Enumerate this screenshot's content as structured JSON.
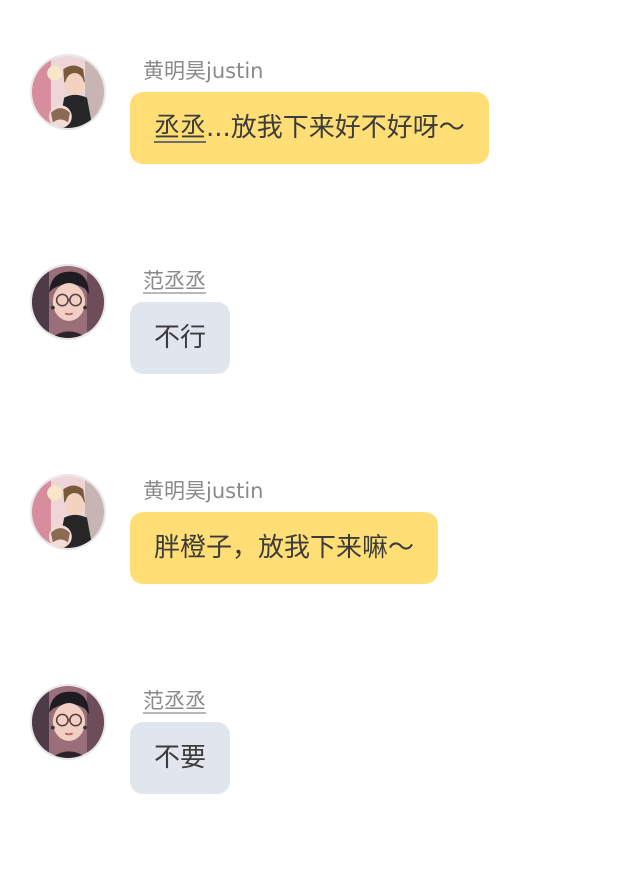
{
  "messages": [
    {
      "sender": "黄明昊justin",
      "avatar_icon": "avatar-huang-minghao-icon",
      "text_underlined": "丞丞",
      "text_rest": "...放我下来好不好呀～",
      "bubble_color": "#ffdf75"
    },
    {
      "sender": "范丞丞",
      "avatar_icon": "avatar-fan-chengcheng-icon",
      "text_underlined": "",
      "text_rest": "不行",
      "bubble_color": "#e0e5ee"
    },
    {
      "sender": "黄明昊justin",
      "avatar_icon": "avatar-huang-minghao-icon",
      "text_underlined": "",
      "text_rest": "胖橙子，放我下来嘛～",
      "bubble_color": "#ffdf75"
    },
    {
      "sender": "范丞丞",
      "avatar_icon": "avatar-fan-chengcheng-icon",
      "text_underlined": "",
      "text_rest": "不要",
      "bubble_color": "#e0e5ee"
    }
  ]
}
